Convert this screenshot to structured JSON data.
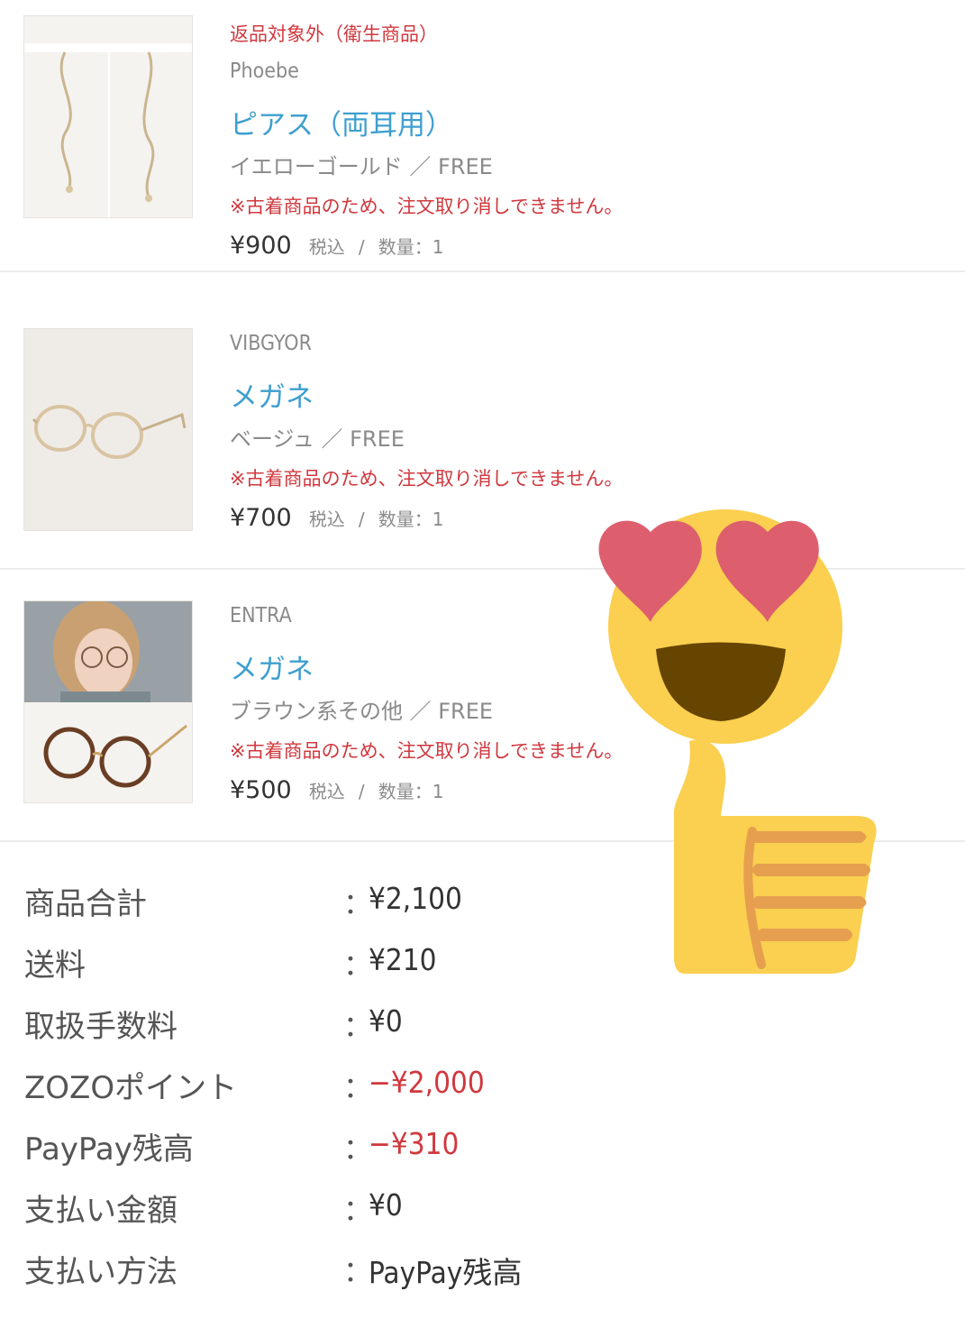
{
  "items": [
    {
      "return_note": "返品対象外（衛生商品）",
      "brand": "Phoebe",
      "name": "ピアス（両耳用）",
      "variant": "イエローゴールド ／ FREE",
      "warning": "※古着商品のため、注文取り消しできません。",
      "price": "¥900",
      "tax": "税込",
      "separator": "/",
      "quantity": "数量：1"
    },
    {
      "brand": "VIBGYOR",
      "name": "メガネ",
      "variant": "ベージュ ／ FREE",
      "warning": "※古着商品のため、注文取り消しできません。",
      "price": "¥700",
      "tax": "税込",
      "separator": "/",
      "quantity": "数量：1"
    },
    {
      "brand": "ENTRA",
      "name": "メガネ",
      "variant": "ブラウン系その他 ／ FREE",
      "warning": "※古着商品のため、注文取り消しできません。",
      "price": "¥500",
      "tax": "税込",
      "separator": "/",
      "quantity": "数量：1"
    }
  ],
  "summary": [
    {
      "label": "商品合計",
      "colon": "：",
      "value": "¥2,100"
    },
    {
      "label": "送料",
      "colon": "：",
      "value": "¥210"
    },
    {
      "label": "取扱手数料",
      "colon": "：",
      "value": "¥0"
    },
    {
      "label": "ZOZOポイント",
      "colon": "：",
      "value": "−¥2,000"
    },
    {
      "label": "PayPay残高",
      "colon": "：",
      "value": "−¥310"
    },
    {
      "label": "支払い金額",
      "colon": "：",
      "value": "¥0"
    },
    {
      "label": "支払い方法",
      "colon": "：",
      "value": "PayPay残高"
    }
  ],
  "colors": {
    "accent_link": "#3f9fcf",
    "warning_red": "#d0383e",
    "emoji_yellow": "#fbcf4f",
    "heart_pink": "#dd5f6e"
  },
  "icons": [
    "earring-thumbnail",
    "glasses-thumbnail",
    "glasses-model-thumbnail",
    "heart-eyes-emoji",
    "thumbs-up-emoji"
  ]
}
